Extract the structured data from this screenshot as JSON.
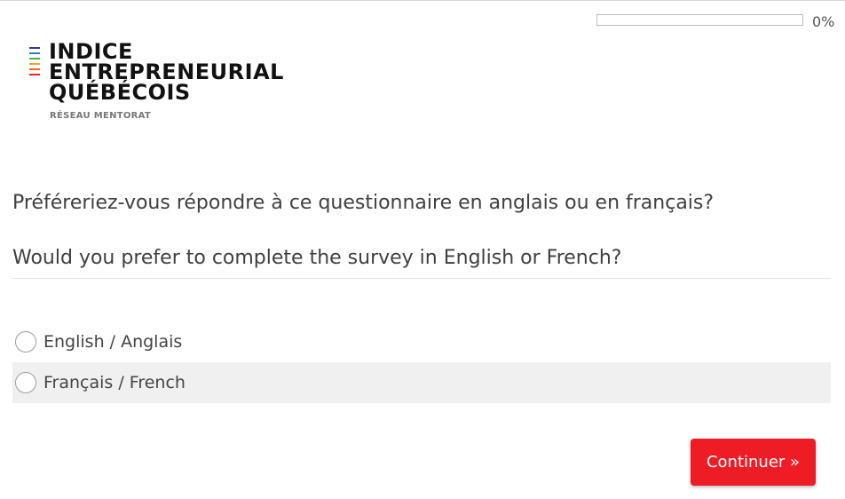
{
  "progress": {
    "value_percent": 0,
    "label": "0%",
    "fill_color": "#e1261c"
  },
  "logo": {
    "line1": "INDICE",
    "line2": "ENTREPRENEURIAL",
    "line3": "QUÉBÉCOIS",
    "subtitle": "RÉSEAU MENTORAT",
    "bar_colors": [
      "#3a3a8c",
      "#2e7cc1",
      "#4caf50",
      "#f5a623",
      "#f26522",
      "#e1261c"
    ]
  },
  "question": {
    "text_fr": "Préféreriez-vous répondre à ce questionnaire en anglais ou en français?",
    "text_en": "Would you prefer to complete the survey in English or French?"
  },
  "options": [
    {
      "label": "English / Anglais",
      "selected": false
    },
    {
      "label": "Français / French",
      "selected": false
    }
  ],
  "actions": {
    "continue_label": "Continuer »",
    "accent_color": "#ee1c24"
  }
}
